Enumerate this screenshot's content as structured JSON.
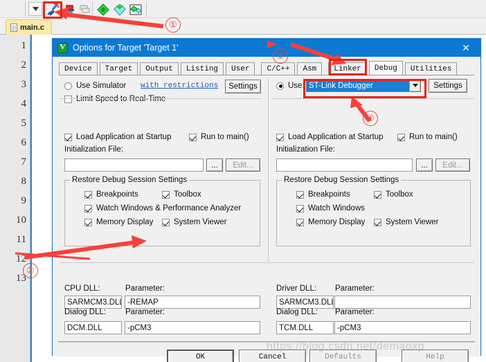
{
  "ide": {
    "toolbar": {
      "chevron_icon": "chevron-down-icon",
      "buttons": [
        {
          "name": "debug-start-stop-icon",
          "tooltip": "Start/Stop Debug Session"
        },
        {
          "name": "insert-remove-breakpoint-icon",
          "tooltip": "Insert/Remove Breakpoint"
        },
        {
          "name": "disable-breakpoint-icon",
          "tooltip": "Disable Breakpoint"
        },
        {
          "name": "green-diamond-icon",
          "tooltip": "Disable All Breakpoints"
        },
        {
          "name": "cyan-diamond-icon",
          "tooltip": "Kill All Breakpoints"
        },
        {
          "name": "multi-diamond-icon",
          "tooltip": "Breakpoints"
        }
      ]
    },
    "file_tab": {
      "label": "main.c",
      "icon": "source-file-icon"
    },
    "gutter_lines": [
      "1",
      "2",
      "3",
      "4",
      "5",
      "6",
      "7",
      "8",
      "9",
      "10",
      "11",
      "12",
      "13"
    ]
  },
  "dialog": {
    "title": "Options for Target 'Target 1'",
    "icon": "uvision-target-icon",
    "close_label": "✕",
    "tabs": [
      {
        "label": "Device",
        "selected": false
      },
      {
        "label": "Target",
        "selected": false
      },
      {
        "label": "Output",
        "selected": false
      },
      {
        "label": "Listing",
        "selected": false
      },
      {
        "label": "User",
        "selected": false
      },
      {
        "label": "C/C++",
        "selected": false
      },
      {
        "label": "Asm",
        "selected": false
      },
      {
        "label": "Linker",
        "selected": false
      },
      {
        "label": "Debug",
        "selected": true
      },
      {
        "label": "Utilities",
        "selected": false
      }
    ],
    "left": {
      "use_simulator_label": "Use Simulator",
      "use_simulator_checked": false,
      "restrictions_link": "with restrictions",
      "settings_label": "Settings",
      "limit_speed_label": "Limit Speed to Real-Time",
      "limit_speed_checked": false,
      "load_app_label": "Load Application at Startup",
      "load_app_checked": true,
      "run_to_main_label": "Run to main()",
      "run_to_main_checked": true,
      "init_file_label": "Initialization File:",
      "init_file_value": "",
      "browse_label": "...",
      "edit_label": "Edit...",
      "restore_group_label": "Restore Debug Session Settings",
      "restore_items": [
        {
          "label": "Breakpoints",
          "checked": true
        },
        {
          "label": "Toolbox",
          "checked": true
        },
        {
          "label": "Watch Windows & Performance Analyzer",
          "checked": true
        },
        {
          "label": "Memory Display",
          "checked": true
        },
        {
          "label": "System Viewer",
          "checked": true
        }
      ],
      "cpu_dll_label": "CPU DLL:",
      "cpu_dll_value": "SARMCM3.DLL",
      "cpu_param_label": "Parameter:",
      "cpu_param_value": "-REMAP",
      "dialog_dll_label": "Dialog DLL:",
      "dialog_dll_value": "DCM.DLL",
      "dialog_param_label": "Parameter:",
      "dialog_param_value": "-pCM3"
    },
    "right": {
      "use_label": "Use:",
      "use_checked": true,
      "debugger_selected": "ST-Link Debugger",
      "debugger_dropdown_icon": "chevron-down-icon",
      "settings_label": "Settings",
      "load_app_label": "Load Application at Startup",
      "load_app_checked": true,
      "run_to_main_label": "Run to main()",
      "run_to_main_checked": true,
      "init_file_label": "Initialization File:",
      "init_file_value": "",
      "browse_label": "...",
      "edit_label": "Edit...",
      "restore_group_label": "Restore Debug Session Settings",
      "restore_items": [
        {
          "label": "Breakpoints",
          "checked": true
        },
        {
          "label": "Toolbox",
          "checked": true
        },
        {
          "label": "Watch Windows",
          "checked": true
        },
        {
          "label": "Memory Display",
          "checked": true
        },
        {
          "label": "System Viewer",
          "checked": true
        }
      ],
      "driver_dll_label": "Driver DLL:",
      "driver_dll_value": "SARMCM3.DLL",
      "driver_param_label": "Parameter:",
      "driver_param_value": "",
      "dialog_dll_label": "Dialog DLL:",
      "dialog_dll_value": "TCM.DLL",
      "dialog_param_label": "Parameter:",
      "dialog_param_value": "-pCM3"
    },
    "footer": {
      "ok_label": "OK",
      "cancel_label": "Cancel",
      "defaults_label": "Defaults",
      "help_label": "Help"
    }
  },
  "annotations": {
    "markers": [
      {
        "id": "1",
        "label": "①"
      },
      {
        "id": "2",
        "label": "②"
      },
      {
        "id": "3",
        "label": "③"
      },
      {
        "id": "4",
        "label": "④"
      }
    ],
    "highlight_color": "#f01f12",
    "marker_color": "#e8463c"
  },
  "watermark": {
    "text": "https://blog.csdn.net/demaoxp"
  }
}
